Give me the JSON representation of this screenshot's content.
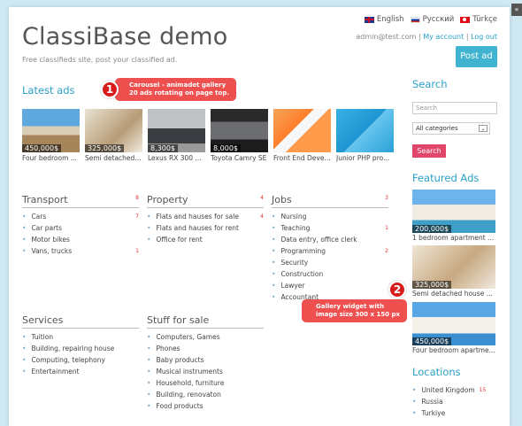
{
  "header": {
    "site_title": "ClassiBase demo",
    "tagline": "Free classifieds site, post your classified ad.",
    "languages": [
      {
        "label": "English",
        "flag": "uk-flag-icon"
      },
      {
        "label": "Русский",
        "flag": "ru-flag-icon"
      },
      {
        "label": "Türkçe",
        "flag": "tr-flag-icon"
      }
    ],
    "user_email": "admin@test.com",
    "my_account": "My account",
    "logout": "Log out",
    "separator": "|",
    "post_ad": "Post ad"
  },
  "latest": {
    "title": "Latest ads",
    "items": [
      {
        "price": "450,000$",
        "caption": "Four bedroom ..."
      },
      {
        "price": "325,000$",
        "caption": "Semi detached ..."
      },
      {
        "price": "8,300$",
        "caption": "Lexus RX 300 ..."
      },
      {
        "price": "8,000$",
        "caption": "Toyota Camry SE"
      },
      {
        "price": "",
        "caption": "Front End Deve..."
      },
      {
        "price": "",
        "caption": "Junior PHP pro..."
      }
    ]
  },
  "categories": [
    {
      "title": "Transport",
      "count": "8",
      "items": [
        {
          "name": "Cars",
          "count": "7"
        },
        {
          "name": "Car parts",
          "count": ""
        },
        {
          "name": "Motor bikes",
          "count": ""
        },
        {
          "name": "Vans, trucks",
          "count": "1"
        }
      ]
    },
    {
      "title": "Property",
      "count": "4",
      "items": [
        {
          "name": "Flats and hauses for sale",
          "count": "4"
        },
        {
          "name": "Flats and hauses for rent",
          "count": ""
        },
        {
          "name": "Office for rent",
          "count": ""
        }
      ]
    },
    {
      "title": "Jobs",
      "count": "3",
      "items": [
        {
          "name": "Nursing",
          "count": ""
        },
        {
          "name": "Teaching",
          "count": "1"
        },
        {
          "name": "Data entry, office clerk",
          "count": ""
        },
        {
          "name": "Programming",
          "count": "2"
        },
        {
          "name": "Security",
          "count": ""
        },
        {
          "name": "Construction",
          "count": ""
        },
        {
          "name": "Lawyer",
          "count": ""
        },
        {
          "name": "Accountant",
          "count": ""
        }
      ]
    },
    {
      "title": "Services",
      "count": "",
      "items": [
        {
          "name": "Tuition",
          "count": ""
        },
        {
          "name": "Building, repairing house",
          "count": ""
        },
        {
          "name": "Computing, telephony",
          "count": ""
        },
        {
          "name": "Entertainment",
          "count": ""
        }
      ]
    },
    {
      "title": "Stuff for sale",
      "count": "",
      "items": [
        {
          "name": "Computers, Games",
          "count": ""
        },
        {
          "name": "Phones",
          "count": ""
        },
        {
          "name": "Baby products",
          "count": ""
        },
        {
          "name": "Musical instruments",
          "count": ""
        },
        {
          "name": "Household, furniture",
          "count": ""
        },
        {
          "name": "Building, renovaton",
          "count": ""
        },
        {
          "name": "Food products",
          "count": ""
        }
      ]
    }
  ],
  "sidebar": {
    "search_title": "Search",
    "search_placeholder": "Search",
    "category_select": "All categories",
    "search_button": "Search",
    "featured_title": "Featured Ads",
    "featured": [
      {
        "price": "200,000$",
        "caption": "1 bedroom apartment ..."
      },
      {
        "price": "325,000$",
        "caption": "Semi detached house ..."
      },
      {
        "price": "450,000$",
        "caption": "Four bedroom apartme..."
      }
    ],
    "locations_title": "Locations",
    "locations": [
      {
        "name": "United Kingdom",
        "count": "15"
      },
      {
        "name": "Russia",
        "count": ""
      },
      {
        "name": "Turkiye",
        "count": ""
      }
    ]
  },
  "callouts": {
    "c1_number": "1",
    "c1_line1": "Carousel - animadet gallery",
    "c1_line2": "20 ads rotating on page top.",
    "c2_number": "2",
    "c2_line1": "Gallery widget with",
    "c2_line2": "image size 300 x 150 px"
  }
}
